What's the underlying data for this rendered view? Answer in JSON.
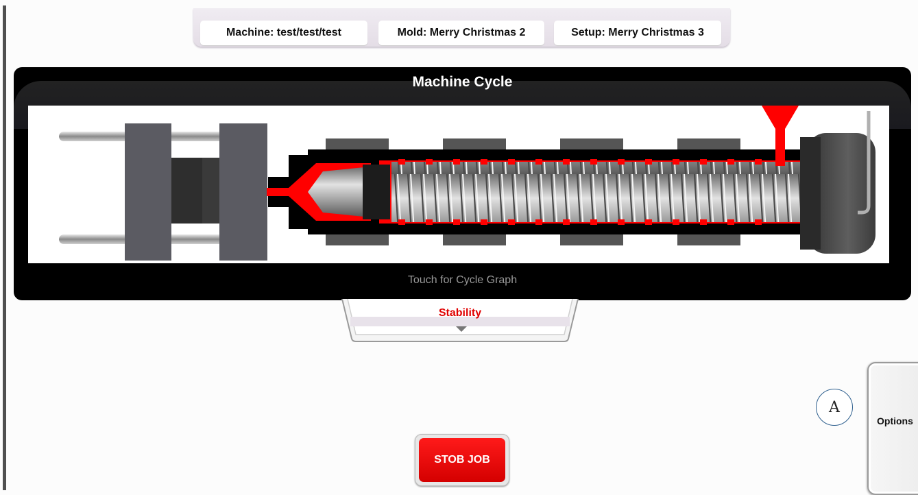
{
  "header": {
    "machine": "Machine: test/test/test",
    "mold": "Mold: Merry Christmas 2",
    "setup": "Setup: Merry Christmas 3"
  },
  "cycle_panel": {
    "title": "Machine Cycle",
    "hint": "Touch for Cycle Graph"
  },
  "stability": {
    "label": "Stability"
  },
  "side": {
    "options_label": "Options",
    "annotation": "A"
  },
  "actions": {
    "stop_job_label": "STOB JOB"
  },
  "colors": {
    "accent_red": "#e00000",
    "panel_black": "#000000",
    "screw_gray": "#b5b5b5",
    "header_tray": "#ebe5ed"
  },
  "icons": {
    "stability_toggle": "chevron-down-icon",
    "machine_graphic": "injection-molding-machine-icon"
  }
}
